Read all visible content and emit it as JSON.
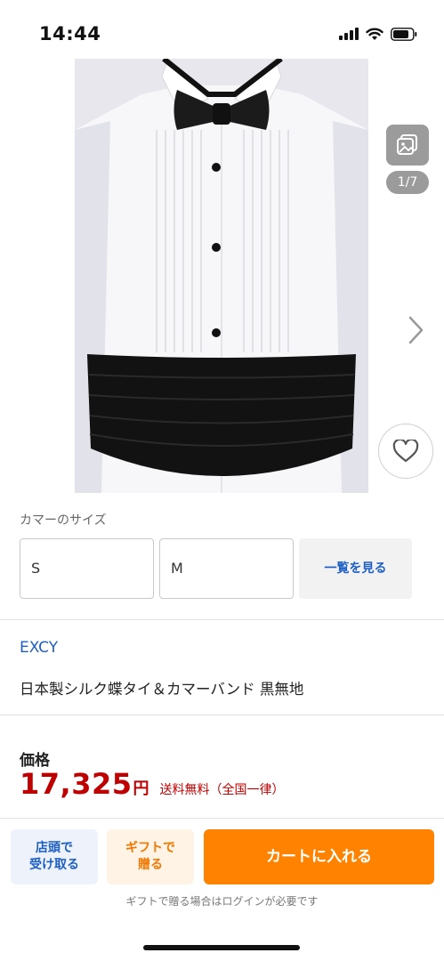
{
  "status_bar": {
    "time": "14:44"
  },
  "gallery": {
    "pager": "1/7",
    "image_alt": "tuxedo shirt with black bow tie and cummerbund",
    "icons": {
      "gallery": "image-stack-icon",
      "next": "chevron-right-icon",
      "favorite": "heart-icon"
    }
  },
  "size_section": {
    "title": "カマーのサイズ",
    "options": [
      "S",
      "M"
    ],
    "view_all": "一覧を見る"
  },
  "product": {
    "brand": "EXCY",
    "name": "日本製シルク蝶タイ＆カマーバンド 黒無地"
  },
  "price": {
    "label": "価格",
    "value": "17,325",
    "currency": "円",
    "shipping": "送料無料（全国一律）"
  },
  "actions": {
    "store_pickup_line1": "店頭で",
    "store_pickup_line2": "受け取る",
    "gift_line1": "ギフトで",
    "gift_line2": "贈る",
    "add_to_cart": "カートに入れる",
    "gift_note": "ギフトで贈る場合はログインが必要です"
  },
  "colors": {
    "link_blue": "#1d5fc4",
    "price_red": "#bf0000",
    "cart_orange": "#ff8300",
    "gift_orange": "#f07800"
  }
}
